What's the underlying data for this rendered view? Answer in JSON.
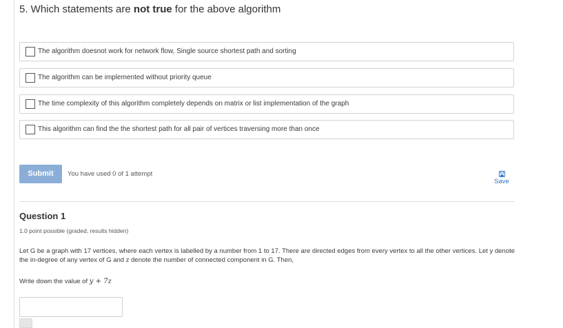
{
  "question5": {
    "title_prefix": "5. Which statements are ",
    "title_emphasis": "not true",
    "title_suffix": " for the above algorithm",
    "options": [
      {
        "label": "The algorithm doesnot work for network flow, Single source shortest path and sorting",
        "checked": false
      },
      {
        "label": "The algorithm can be implemented without priority queue",
        "checked": false
      },
      {
        "label": "The time complexity of this algorithm completely depends on matrix or list implementation of the graph",
        "checked": false
      },
      {
        "label": "This algorithm can find the the shortest path for all pair of vertices traversing more than once",
        "checked": false
      }
    ]
  },
  "actions": {
    "submit_label": "Submit",
    "attempts_text": "You have used 0 of 1 attempt",
    "save_label": "Save",
    "save_icon": "floppy-disk-icon"
  },
  "question1": {
    "title": "Question 1",
    "points": "1.0 point possible (graded, results hidden)",
    "body": "Let G be a graph with 17 vertices, where each vertex is labelled by a number from 1 to 17. There are directed edges from every vertex to all the other vertices. Let y denote the in-degree of any vertex of G and z denote the number of connected component in G. Then,",
    "prompt_text": "Write down the value of ",
    "prompt_math": "y + 7z",
    "answer_value": ""
  },
  "colors": {
    "submit_bg": "#8aaed8",
    "link": "#2a73c0",
    "border": "#d2d2d2"
  }
}
